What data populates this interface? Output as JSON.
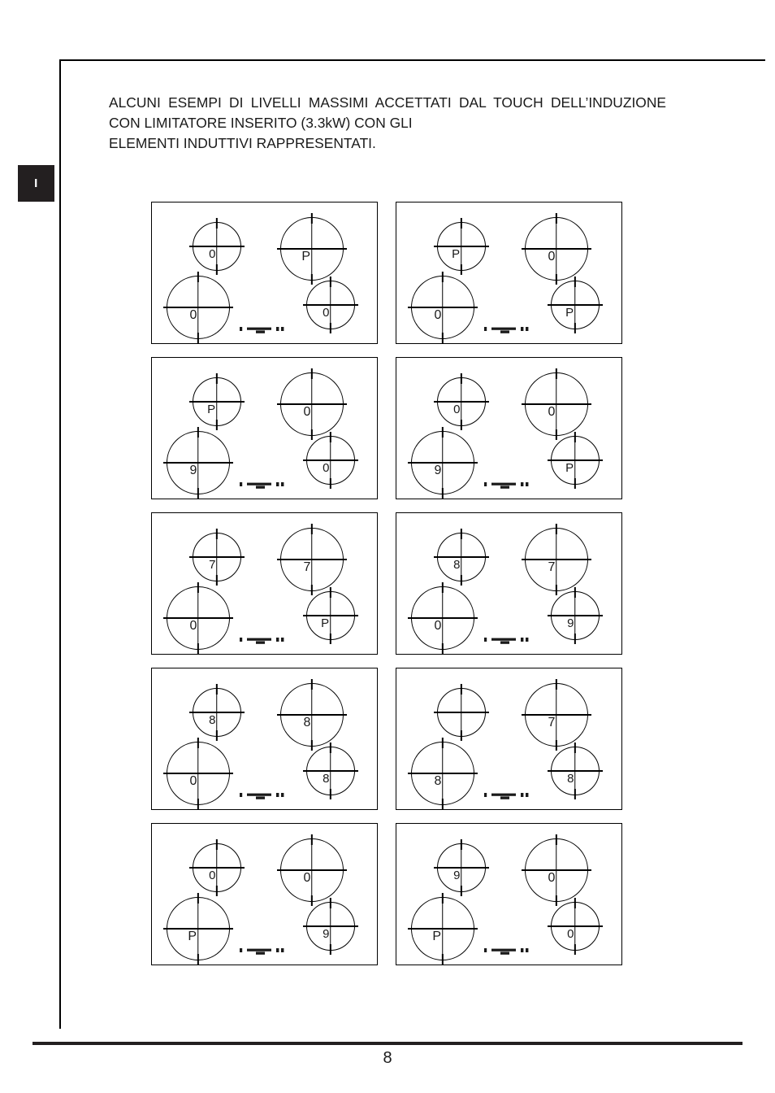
{
  "language_tab": {
    "label": "I"
  },
  "heading": {
    "line1": "ALCUNI ESEMPI DI LIVELLI MASSIMI ACCETTATI DAL TOUCH",
    "line2": "DELL’INDUZIONE CON LIMITATORE INSERITO (3.3kW) CON GLI",
    "line3": "ELEMENTI INDUTTIVI RAPPRESENTATI."
  },
  "footer": {
    "page_number": "8"
  },
  "colors": {
    "ink": "#1a1a1a",
    "rule": "#231f20",
    "tab_background": "#231f20",
    "tab_text": "#ffffff",
    "page_background": "#ffffff"
  },
  "diagram_legend": {
    "zone_label_zero": "0",
    "zone_label_power": "P",
    "control_strip_name": "touch-control-strip"
  },
  "panels": [
    {
      "id": "panel-1",
      "zones": [
        {
          "position": "top-left",
          "label": "0",
          "size": "small"
        },
        {
          "position": "top-right",
          "label": "P",
          "size": "big"
        },
        {
          "position": "bottom-left",
          "label": "0",
          "size": "big"
        },
        {
          "position": "bottom-right",
          "label": "0",
          "size": "small"
        }
      ]
    },
    {
      "id": "panel-2",
      "zones": [
        {
          "position": "top-left",
          "label": "P",
          "size": "small"
        },
        {
          "position": "top-right",
          "label": "0",
          "size": "big"
        },
        {
          "position": "bottom-left",
          "label": "0",
          "size": "big"
        },
        {
          "position": "bottom-right",
          "label": "P",
          "size": "small"
        }
      ]
    },
    {
      "id": "panel-3",
      "zones": [
        {
          "position": "top-left",
          "label": "P",
          "size": "small"
        },
        {
          "position": "top-right",
          "label": "0",
          "size": "big"
        },
        {
          "position": "bottom-left",
          "label": "9",
          "size": "big"
        },
        {
          "position": "bottom-right",
          "label": "0",
          "size": "small"
        }
      ]
    },
    {
      "id": "panel-4",
      "zones": [
        {
          "position": "top-left",
          "label": "0",
          "size": "small"
        },
        {
          "position": "top-right",
          "label": "0",
          "size": "big"
        },
        {
          "position": "bottom-left",
          "label": "9",
          "size": "big"
        },
        {
          "position": "bottom-right",
          "label": "P",
          "size": "small"
        }
      ]
    },
    {
      "id": "panel-5",
      "zones": [
        {
          "position": "top-left",
          "label": "7",
          "size": "small"
        },
        {
          "position": "top-right",
          "label": "7",
          "size": "big"
        },
        {
          "position": "bottom-left",
          "label": "0",
          "size": "big"
        },
        {
          "position": "bottom-right",
          "label": "P",
          "size": "small"
        }
      ]
    },
    {
      "id": "panel-6",
      "zones": [
        {
          "position": "top-left",
          "label": "8",
          "size": "small"
        },
        {
          "position": "top-right",
          "label": "7",
          "size": "big"
        },
        {
          "position": "bottom-left",
          "label": "0",
          "size": "big"
        },
        {
          "position": "bottom-right",
          "label": "9",
          "size": "small"
        }
      ]
    },
    {
      "id": "panel-7",
      "zones": [
        {
          "position": "top-left",
          "label": "8",
          "size": "small"
        },
        {
          "position": "top-right",
          "label": "8",
          "size": "big"
        },
        {
          "position": "bottom-left",
          "label": "0",
          "size": "big"
        },
        {
          "position": "bottom-right",
          "label": "8",
          "size": "small"
        }
      ]
    },
    {
      "id": "panel-8",
      "zones": [
        {
          "position": "top-left",
          "label": "",
          "size": "small"
        },
        {
          "position": "top-right",
          "label": "7",
          "size": "big"
        },
        {
          "position": "bottom-left",
          "label": "8",
          "size": "big"
        },
        {
          "position": "bottom-right",
          "label": "8",
          "size": "small"
        }
      ]
    },
    {
      "id": "panel-9",
      "zones": [
        {
          "position": "top-left",
          "label": "0",
          "size": "small"
        },
        {
          "position": "top-right",
          "label": "0",
          "size": "big"
        },
        {
          "position": "bottom-left",
          "label": "P",
          "size": "big"
        },
        {
          "position": "bottom-right",
          "label": "9",
          "size": "small"
        }
      ]
    },
    {
      "id": "panel-10",
      "zones": [
        {
          "position": "top-left",
          "label": "9",
          "size": "small"
        },
        {
          "position": "top-right",
          "label": "0",
          "size": "big"
        },
        {
          "position": "bottom-left",
          "label": "P",
          "size": "big"
        },
        {
          "position": "bottom-right",
          "label": "0",
          "size": "small"
        }
      ]
    }
  ]
}
